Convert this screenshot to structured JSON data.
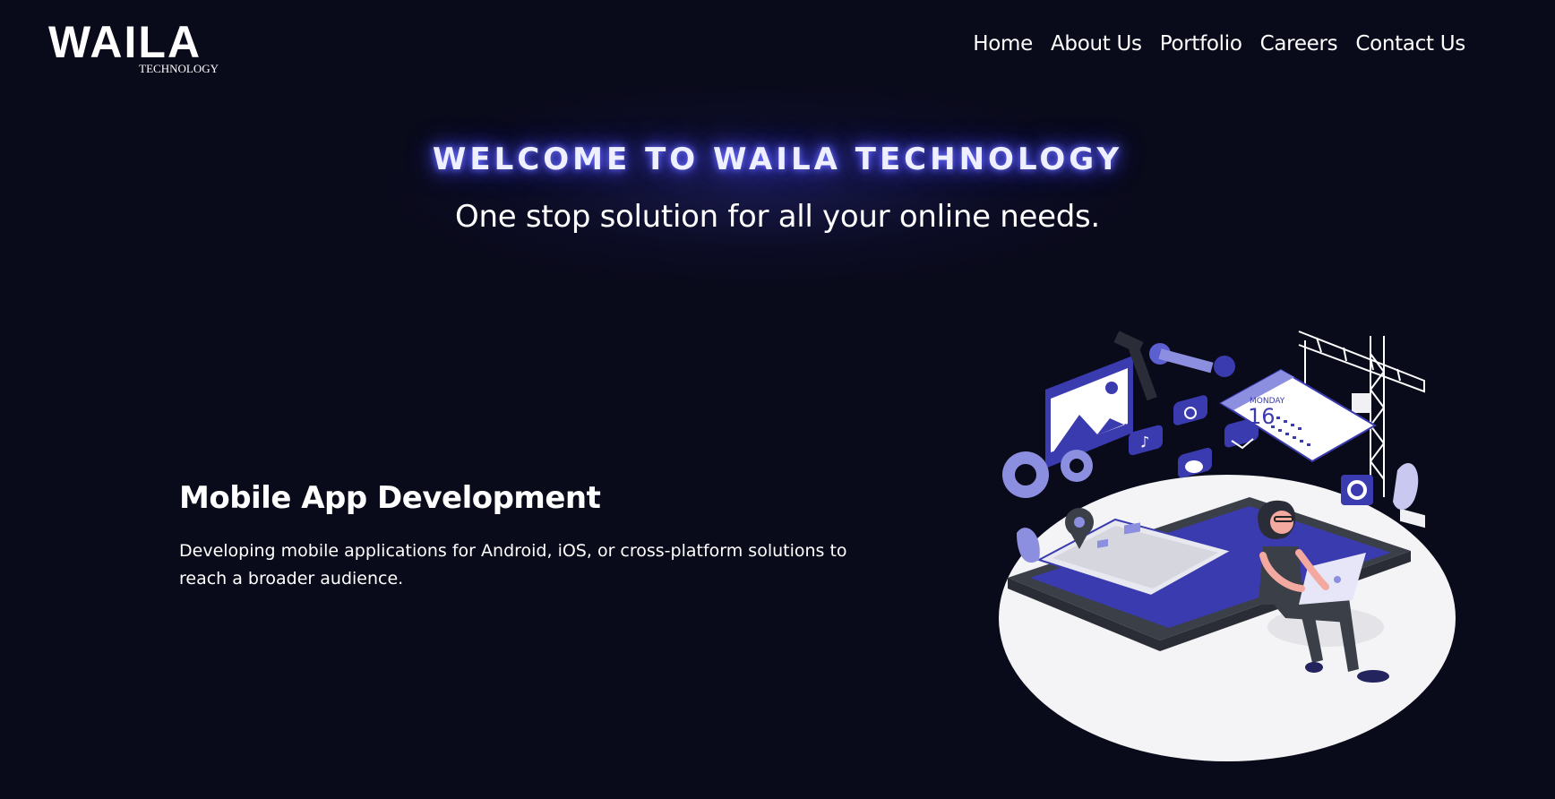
{
  "header": {
    "logo_text": "WAILA",
    "logo_subtext": "TECHNOLOGY",
    "nav": [
      {
        "label": "Home"
      },
      {
        "label": "About Us"
      },
      {
        "label": "Portfolio"
      },
      {
        "label": "Careers"
      },
      {
        "label": "Contact Us"
      }
    ]
  },
  "hero": {
    "title": "WELCOME TO WAILA TECHNOLOGY",
    "subtitle": "One stop solution for all your online needs."
  },
  "service": {
    "title": "Mobile App Development",
    "description": "Developing mobile applications for Android, iOS, or cross-platform solutions to reach a broader audience."
  },
  "illustration": {
    "calendar_day_label": "MONDAY",
    "calendar_date": "16"
  },
  "colors": {
    "background": "#090a1a",
    "accent": "#3b3bb0",
    "accent_light": "#8c8ee0",
    "text": "#ffffff"
  }
}
